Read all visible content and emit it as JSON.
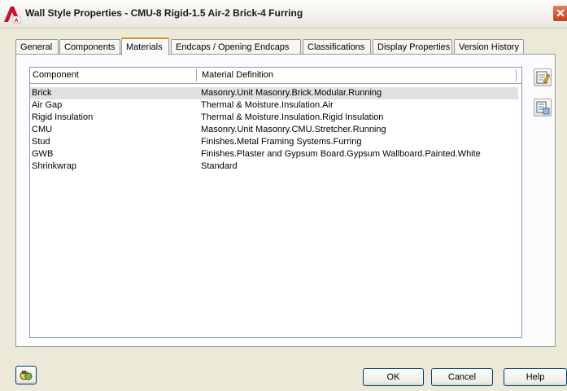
{
  "window": {
    "title": "Wall Style Properties - CMU-8 Rigid-1.5 Air-2 Brick-4 Furring",
    "close_glyph": "✕"
  },
  "tabs": [
    {
      "label": "General",
      "active": false
    },
    {
      "label": "Components",
      "active": false
    },
    {
      "label": "Materials",
      "active": true
    },
    {
      "label": "Endcaps / Opening Endcaps",
      "active": false
    },
    {
      "label": "Classifications",
      "active": false
    },
    {
      "label": "Display Properties",
      "active": false
    },
    {
      "label": "Version History",
      "active": false
    }
  ],
  "table": {
    "columns": [
      "Component",
      "Material Definition"
    ],
    "rows": [
      {
        "component": "Brick",
        "material": "Masonry.Unit Masonry.Brick.Modular.Running",
        "selected": true
      },
      {
        "component": "Air Gap",
        "material": "Thermal & Moisture.Insulation.Air",
        "selected": false
      },
      {
        "component": "Rigid Insulation",
        "material": "Thermal & Moisture.Insulation.Rigid Insulation",
        "selected": false
      },
      {
        "component": "CMU",
        "material": "Masonry.Unit Masonry.CMU.Stretcher.Running",
        "selected": false
      },
      {
        "component": "Stud",
        "material": "Finishes.Metal Framing Systems.Furring",
        "selected": false
      },
      {
        "component": "GWB",
        "material": "Finishes.Plaster and Gypsum Board.Gypsum Wallboard.Painted.White",
        "selected": false
      },
      {
        "component": "Shrinkwrap",
        "material": "Standard",
        "selected": false
      }
    ]
  },
  "side_buttons": [
    {
      "icon": "edit-material-icon"
    },
    {
      "icon": "material-list-icon"
    }
  ],
  "footer": {
    "ok_label": "OK",
    "cancel_label": "Cancel",
    "help_label": "Help",
    "style_browser_icon": "style-browser-icon"
  }
}
